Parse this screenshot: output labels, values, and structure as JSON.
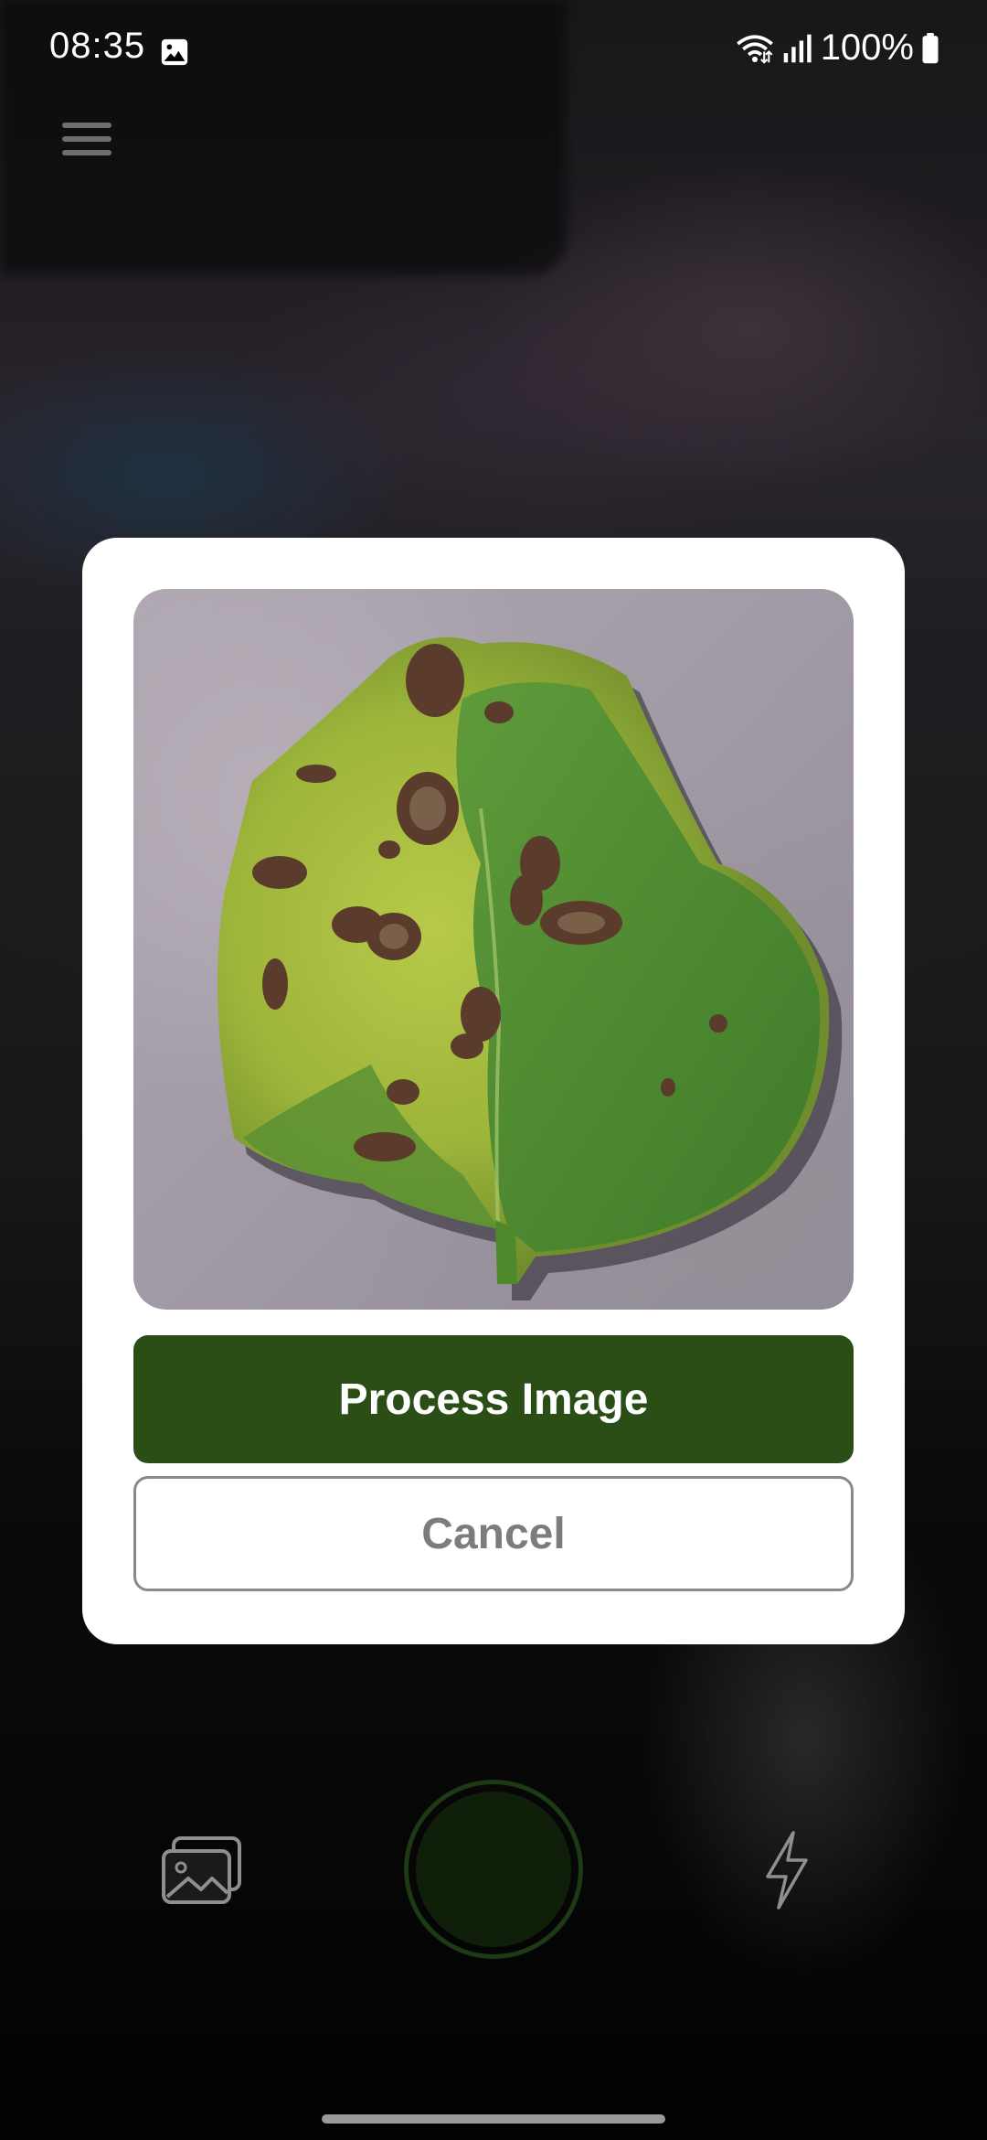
{
  "status_bar": {
    "time": "08:35",
    "battery": "100%",
    "icons": [
      "image-notification-icon",
      "wifi-icon",
      "signal-icon",
      "battery-icon"
    ]
  },
  "camera": {
    "menu_icon": "menu-icon",
    "gallery_icon": "gallery-icon",
    "shutter": "shutter-button",
    "flash_icon": "flash-icon"
  },
  "dialog": {
    "image_alt": "tomato leaf with brown spots",
    "process_label": "Process Image",
    "cancel_label": "Cancel"
  },
  "colors": {
    "primary": "#2a4e16",
    "cancel_text": "#7c7c7c",
    "dialog_bg": "#ffffff"
  }
}
